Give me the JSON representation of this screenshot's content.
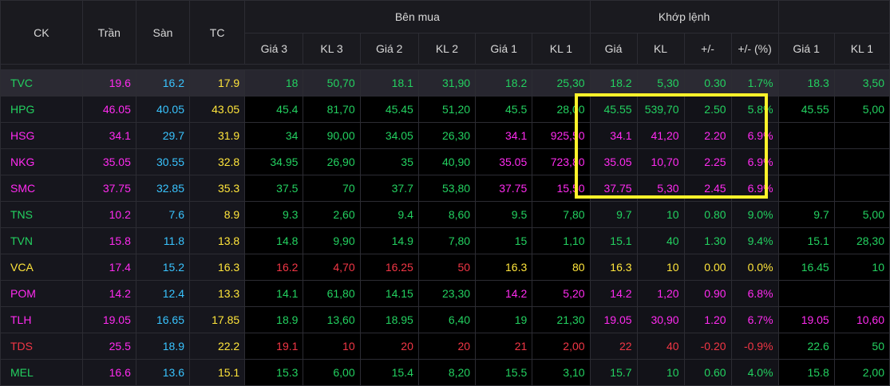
{
  "header": {
    "ck": "CK",
    "tran": "Trần",
    "san": "Sàn",
    "tc": "TC",
    "ben_mua": "Bên mua",
    "khop_lenh": "Khớp lệnh",
    "buy_cols": [
      "Giá 3",
      "KL 3",
      "Giá 2",
      "KL 2",
      "Giá 1",
      "KL 1"
    ],
    "match_cols": [
      "Giá",
      "KL",
      "+/-",
      "+/- (%)"
    ],
    "sell_cols": [
      "Giá 1",
      "KL 1"
    ]
  },
  "colors": {
    "up": "#23d160",
    "down": "#f23645",
    "ref": "#ffe53b",
    "ceiling": "#ff2bf0",
    "floor": "#39c4ff",
    "highlight_box": "#fff22a"
  },
  "rows": [
    {
      "sym": "TVC",
      "c": "up",
      "tran": "19.6",
      "san": "16.2",
      "tc": "17.9",
      "b": [
        [
          "18",
          "50,70",
          "up"
        ],
        [
          "18.1",
          "31,90",
          "up"
        ],
        [
          "18.2",
          "25,30",
          "up"
        ]
      ],
      "m": [
        "18.2",
        "5,30",
        "0.30",
        "1.7%"
      ],
      "mc": "up",
      "s": [
        [
          "18.3",
          "3,50",
          "up"
        ]
      ],
      "hl": true
    },
    {
      "sym": "HPG",
      "c": "up",
      "tran": "46.05",
      "san": "40.05",
      "tc": "43.05",
      "b": [
        [
          "45.4",
          "81,70",
          "up"
        ],
        [
          "45.45",
          "51,20",
          "up"
        ],
        [
          "45.5",
          "28,00",
          "up"
        ]
      ],
      "m": [
        "45.55",
        "539,70",
        "2.50",
        "5.8%"
      ],
      "mc": "up",
      "s": [
        [
          "45.55",
          "5,00",
          "up"
        ]
      ]
    },
    {
      "sym": "HSG",
      "c": "ceil",
      "tran": "34.1",
      "san": "29.7",
      "tc": "31.9",
      "b": [
        [
          "34",
          "90,00",
          "up"
        ],
        [
          "34.05",
          "26,30",
          "up"
        ],
        [
          "34.1",
          "925,50",
          "ceil"
        ]
      ],
      "m": [
        "34.1",
        "41,20",
        "2.20",
        "6.9%"
      ],
      "mc": "ceil",
      "s": [
        [
          "",
          "",
          " "
        ]
      ]
    },
    {
      "sym": "NKG",
      "c": "ceil",
      "tran": "35.05",
      "san": "30.55",
      "tc": "32.8",
      "b": [
        [
          "34.95",
          "26,90",
          "up"
        ],
        [
          "35",
          "40,90",
          "up"
        ],
        [
          "35.05",
          "723,80",
          "ceil"
        ]
      ],
      "m": [
        "35.05",
        "10,70",
        "2.25",
        "6.9%"
      ],
      "mc": "ceil",
      "s": [
        [
          "",
          "",
          " "
        ]
      ]
    },
    {
      "sym": "SMC",
      "c": "ceil",
      "tran": "37.75",
      "san": "32.85",
      "tc": "35.3",
      "b": [
        [
          "37.5",
          "70",
          "up"
        ],
        [
          "37.7",
          "53,80",
          "up"
        ],
        [
          "37.75",
          "15,50",
          "ceil"
        ]
      ],
      "m": [
        "37.75",
        "5,30",
        "2.45",
        "6.9%"
      ],
      "mc": "ceil",
      "s": [
        [
          "",
          "",
          " "
        ]
      ]
    },
    {
      "sym": "TNS",
      "c": "up",
      "tran": "10.2",
      "san": "7.6",
      "tc": "8.9",
      "b": [
        [
          "9.3",
          "2,60",
          "up"
        ],
        [
          "9.4",
          "8,60",
          "up"
        ],
        [
          "9.5",
          "7,80",
          "up"
        ]
      ],
      "m": [
        "9.7",
        "10",
        "0.80",
        "9.0%"
      ],
      "mc": "up",
      "s": [
        [
          "9.7",
          "5,00",
          "up"
        ]
      ]
    },
    {
      "sym": "TVN",
      "c": "up",
      "tran": "15.8",
      "san": "11.8",
      "tc": "13.8",
      "b": [
        [
          "14.8",
          "9,90",
          "up"
        ],
        [
          "14.9",
          "7,80",
          "up"
        ],
        [
          "15",
          "1,10",
          "up"
        ]
      ],
      "m": [
        "15.1",
        "40",
        "1.30",
        "9.4%"
      ],
      "mc": "up",
      "s": [
        [
          "15.1",
          "28,30",
          "up"
        ]
      ]
    },
    {
      "sym": "VCA",
      "c": "ref",
      "tran": "17.4",
      "san": "15.2",
      "tc": "16.3",
      "b": [
        [
          "16.2",
          "4,70",
          "down"
        ],
        [
          "16.25",
          "50",
          "down"
        ],
        [
          "16.3",
          "80",
          "ref"
        ]
      ],
      "m": [
        "16.3",
        "10",
        "0.00",
        "0.0%"
      ],
      "mc": "ref",
      "s": [
        [
          "16.45",
          "10",
          "up"
        ]
      ]
    },
    {
      "sym": "POM",
      "c": "ceil",
      "tran": "14.2",
      "san": "12.4",
      "tc": "13.3",
      "b": [
        [
          "14.1",
          "61,80",
          "up"
        ],
        [
          "14.15",
          "23,30",
          "up"
        ],
        [
          "14.2",
          "5,20",
          "ceil"
        ]
      ],
      "m": [
        "14.2",
        "1,20",
        "0.90",
        "6.8%"
      ],
      "mc": "ceil",
      "s": [
        [
          "",
          "",
          " "
        ]
      ]
    },
    {
      "sym": "TLH",
      "c": "ceil",
      "tran": "19.05",
      "san": "16.65",
      "tc": "17.85",
      "b": [
        [
          "18.9",
          "13,60",
          "up"
        ],
        [
          "18.95",
          "6,40",
          "up"
        ],
        [
          "19",
          "21,30",
          "up"
        ]
      ],
      "m": [
        "19.05",
        "30,90",
        "1.20",
        "6.7%"
      ],
      "mc": "ceil",
      "s": [
        [
          "19.05",
          "10,60",
          "ceil"
        ]
      ]
    },
    {
      "sym": "TDS",
      "c": "down",
      "tran": "25.5",
      "san": "18.9",
      "tc": "22.2",
      "b": [
        [
          "19.1",
          "10",
          "down"
        ],
        [
          "20",
          "20",
          "down"
        ],
        [
          "21",
          "2,00",
          "down"
        ]
      ],
      "m": [
        "22",
        "40",
        "-0.20",
        "-0.9%"
      ],
      "mc": "down",
      "s": [
        [
          "22.6",
          "50",
          "up"
        ]
      ]
    },
    {
      "sym": "MEL",
      "c": "up",
      "tran": "16.6",
      "san": "13.6",
      "tc": "15.1",
      "b": [
        [
          "15.3",
          "6,00",
          "up"
        ],
        [
          "15.4",
          "8,20",
          "up"
        ],
        [
          "15.5",
          "3,10",
          "up"
        ]
      ],
      "m": [
        "15.7",
        "10",
        "0.60",
        "4.0%"
      ],
      "mc": "up",
      "s": [
        [
          "15.8",
          "2,00",
          "up"
        ]
      ]
    }
  ]
}
